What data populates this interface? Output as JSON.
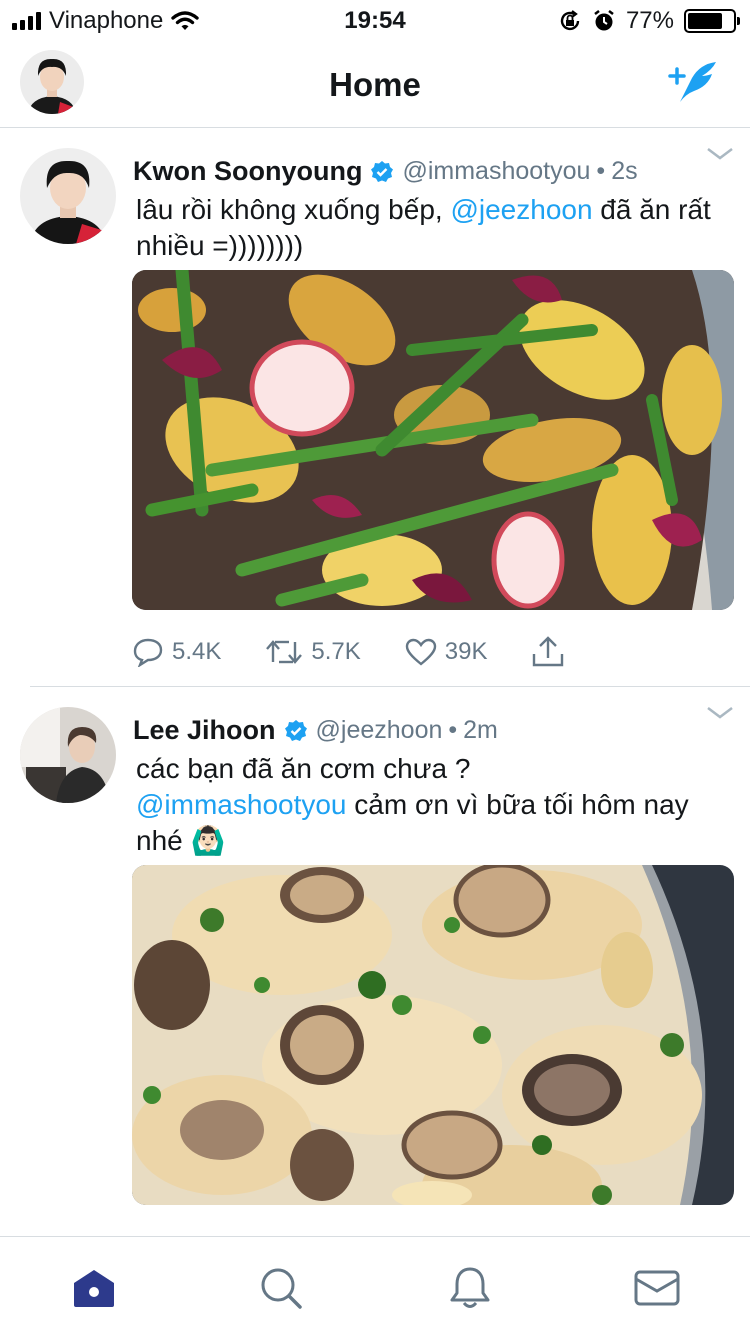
{
  "status_bar": {
    "carrier": "Vinaphone",
    "time": "19:54",
    "battery_percent": "77%",
    "battery_level": 0.77,
    "icons": [
      "signal-icon",
      "wifi-icon",
      "rotation-lock-icon",
      "alarm-icon",
      "battery-icon"
    ]
  },
  "header": {
    "title": "Home",
    "compose_icon": "compose-tweet-icon"
  },
  "tweets": [
    {
      "name": "Kwon Soonyoung",
      "handle": "@immashootyou",
      "dot": "•",
      "time": "2s",
      "text_parts": [
        "lâu rồi không xuống bếp, ",
        "@jeezhoon",
        " đã ăn rất nhiều =))))))))"
      ],
      "replies": "5.4K",
      "retweets": "5.7K",
      "likes": "39K"
    },
    {
      "name": "Lee Jihoon",
      "handle": "@jeezhoon",
      "dot": "•",
      "time": "2m",
      "text_parts": [
        "các bạn đã ăn cơm chưa ?",
        "@immashootyou",
        " cảm ơn vì bữa tối hôm nay nhé ",
        "🙆🏻‍♂️"
      ]
    }
  ],
  "tabbar": {
    "tabs": [
      "home-tab",
      "search-tab",
      "notifications-tab",
      "messages-tab"
    ],
    "accent": "#1da1f2",
    "active_color": "#2d3a8c"
  }
}
